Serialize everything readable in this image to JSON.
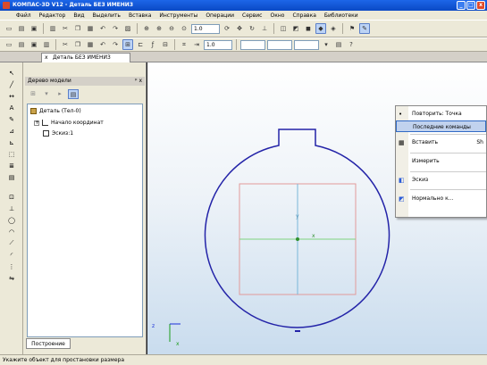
{
  "window": {
    "title": "КОМПАС-3D V12 - Деталь БЕЗ ИМЕНИ3",
    "buttons": [
      "_",
      "□",
      "x"
    ]
  },
  "menu": [
    "Файл",
    "Редактор",
    "Вид",
    "Выделить",
    "Вставка",
    "Инструменты",
    "Операции",
    "Сервис",
    "Окно",
    "Справка",
    "Библиотеки"
  ],
  "toolbar1": {
    "zoom_value": "1.0"
  },
  "toolbar2": {
    "step_value": "1.0"
  },
  "document_tab": {
    "label": "Деталь БЕЗ ИМЕНИ3",
    "close": "x"
  },
  "model_tree": {
    "title": "Дерево модели",
    "header_buttons": "ᵖ x",
    "rows": [
      {
        "label": "Деталь (Тел-0)",
        "expander": ""
      },
      {
        "label": "Начало координат",
        "expander": "+"
      },
      {
        "label": "Эскиз:1",
        "expander": ""
      }
    ],
    "bottom_tab": "Построение"
  },
  "context_menu": {
    "items": [
      {
        "label": "Повторить: Точка",
        "highlighted": false
      },
      {
        "label": "Последние команды",
        "highlighted": true
      },
      {
        "label": "Вставить",
        "shortcut": "Sh",
        "highlighted": false
      },
      {
        "label": "Измерить",
        "highlighted": false
      },
      {
        "label": "Эскиз",
        "highlighted": false
      },
      {
        "label": "Нормально к...",
        "highlighted": false
      }
    ]
  },
  "axes": {
    "x": "x",
    "y": "y",
    "z": "z"
  },
  "status_bar": {
    "text": "Укажите объект для простановки размера"
  },
  "colors": {
    "sketch_line": "#2323a8",
    "rect_line": "#e29a9a",
    "axis_x": "#7fd47f",
    "axis_y": "#79b7d9",
    "highlight": "#c1d2ee"
  }
}
